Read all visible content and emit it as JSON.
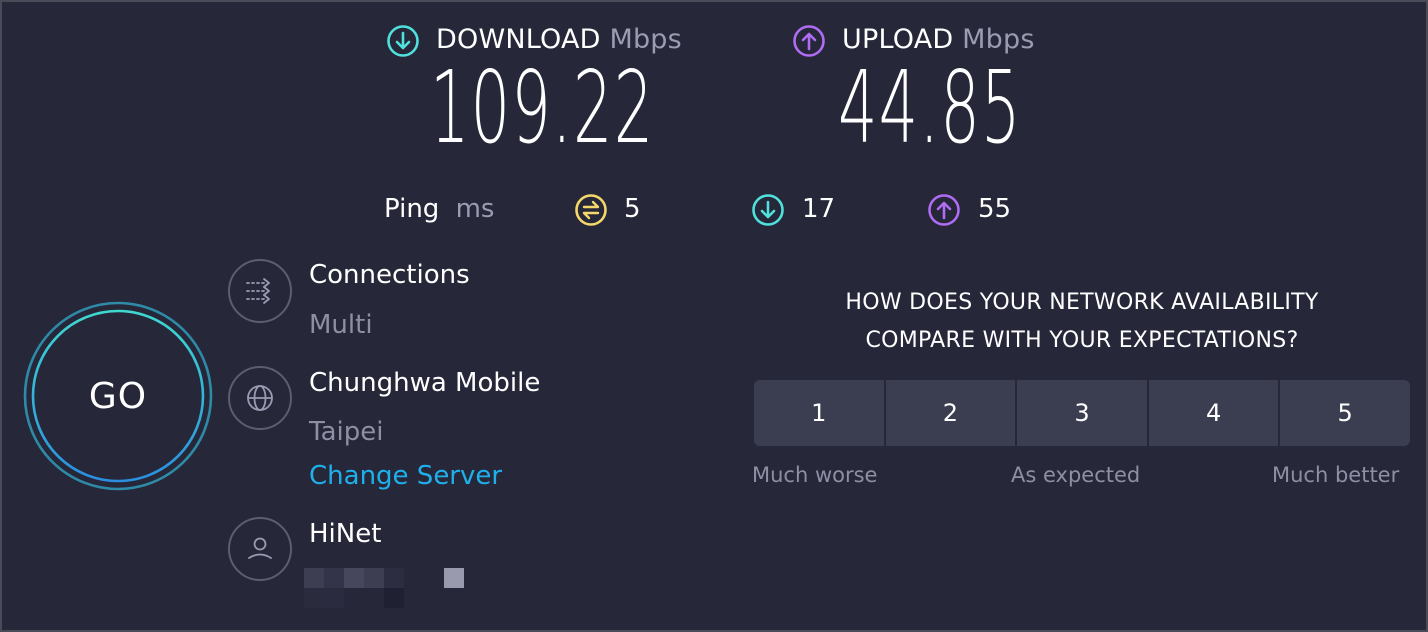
{
  "download": {
    "label": "DOWNLOAD",
    "unit": "Mbps",
    "value": "109.22",
    "icon": "download-arrow-icon",
    "color": "#4fe1dc"
  },
  "upload": {
    "label": "UPLOAD",
    "unit": "Mbps",
    "value": "44.85",
    "icon": "upload-arrow-icon",
    "color": "#b06cf3"
  },
  "ping": {
    "label": "Ping",
    "unit": "ms",
    "idle": {
      "value": "5",
      "icon": "ping-idle-icon",
      "color": "#f5d86a"
    },
    "download": {
      "value": "17",
      "icon": "download-arrow-icon",
      "color": "#4fe1dc"
    },
    "upload": {
      "value": "55",
      "icon": "upload-arrow-icon",
      "color": "#b06cf3"
    }
  },
  "go_button": {
    "label": "GO"
  },
  "connections": {
    "title": "Connections",
    "value": "Multi",
    "icon": "connections-icon"
  },
  "server": {
    "name": "Chunghwa Mobile",
    "location": "Taipei",
    "change_link": "Change Server",
    "icon": "globe-icon"
  },
  "isp": {
    "name": "HiNet",
    "ip_redacted": true,
    "icon": "user-icon"
  },
  "survey": {
    "question_line1": "HOW DOES YOUR NETWORK AVAILABILITY",
    "question_line2": "COMPARE WITH YOUR EXPECTATIONS?",
    "options": [
      "1",
      "2",
      "3",
      "4",
      "5"
    ],
    "scale_low": "Much worse",
    "scale_mid": "As expected",
    "scale_high": "Much better"
  },
  "colors": {
    "background": "#262739",
    "link": "#1fb0ec",
    "muted_text": "#9b9bb2",
    "rating_button": "#3b3d51"
  }
}
